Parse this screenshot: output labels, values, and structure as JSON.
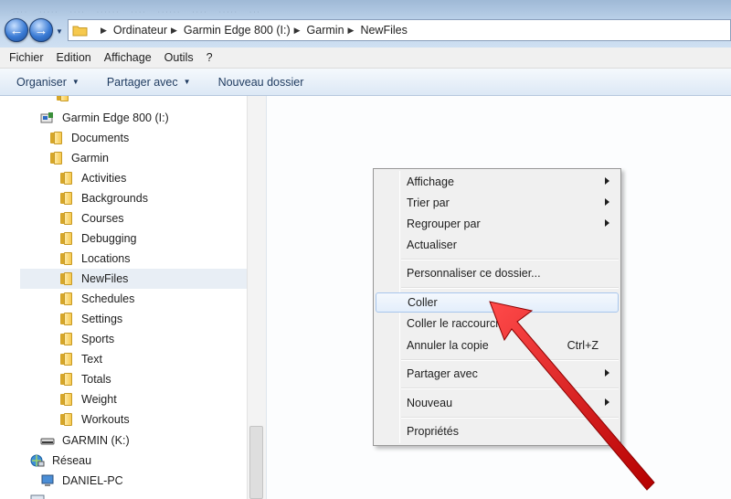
{
  "address_bar": {
    "crumbs": [
      "Ordinateur",
      "Garmin Edge 800 (I:)",
      "Garmin",
      "NewFiles"
    ]
  },
  "menu_bar": [
    "Fichier",
    "Edition",
    "Affichage",
    "Outils",
    "?"
  ],
  "command_bar": {
    "organize": "Organiser",
    "share": "Partager avec",
    "new_folder": "Nouveau dossier"
  },
  "nav_tree": {
    "drive": "Garmin Edge 800 (I:)",
    "documents": "Documents",
    "garmin": "Garmin",
    "subfolders": [
      "Activities",
      "Backgrounds",
      "Courses",
      "Debugging",
      "Locations",
      "NewFiles",
      "Schedules",
      "Settings",
      "Sports",
      "Text",
      "Totals",
      "Weight",
      "Workouts"
    ],
    "selected": "NewFiles",
    "garmin_k": "GARMIN (K:)",
    "network": "Réseau",
    "pc": "DANIEL-PC"
  },
  "context_menu": {
    "view": "Affichage",
    "sort_by": "Trier par",
    "group_by": "Regrouper par",
    "refresh": "Actualiser",
    "customize": "Personnaliser ce dossier...",
    "paste": "Coller",
    "paste_shortcut": "Coller le raccourci",
    "undo_copy": "Annuler la copie",
    "undo_copy_key": "Ctrl+Z",
    "share_with": "Partager avec",
    "new": "Nouveau",
    "properties": "Propriétés"
  },
  "colors": {
    "highlight_border": "#a8c6ec",
    "annotation_arrow": "#e11414"
  },
  "icons": [
    "back-arrow-icon",
    "forward-arrow-icon",
    "folder-icon",
    "drive-icon",
    "network-icon",
    "computer-icon",
    "submenu-arrow-icon"
  ]
}
